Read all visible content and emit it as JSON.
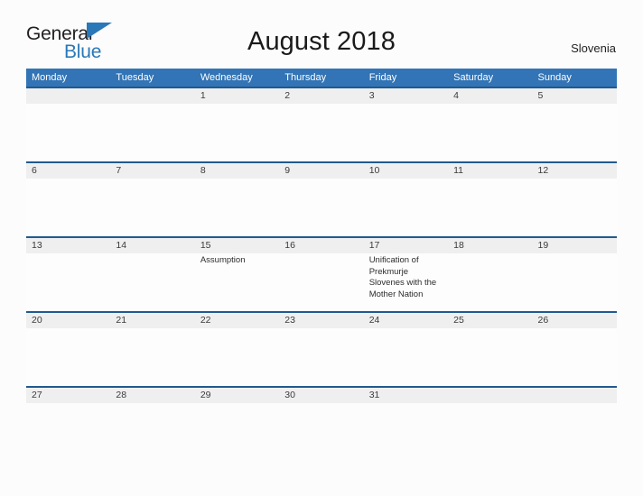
{
  "brand": {
    "line1": "General",
    "line2": "Blue",
    "accent_color": "#2a78b8",
    "text_color": "#231f20"
  },
  "header": {
    "title": "August 2018",
    "country": "Slovenia"
  },
  "calendar": {
    "header_bg": "#3274b5",
    "date_band_bg": "#efefef",
    "week_divider_color": "#21598f",
    "weekdays": [
      "Monday",
      "Tuesday",
      "Wednesday",
      "Thursday",
      "Friday",
      "Saturday",
      "Sunday"
    ],
    "weeks": [
      {
        "days": [
          {
            "num": "",
            "event": ""
          },
          {
            "num": "",
            "event": ""
          },
          {
            "num": "1",
            "event": ""
          },
          {
            "num": "2",
            "event": ""
          },
          {
            "num": "3",
            "event": ""
          },
          {
            "num": "4",
            "event": ""
          },
          {
            "num": "5",
            "event": ""
          }
        ]
      },
      {
        "days": [
          {
            "num": "6",
            "event": ""
          },
          {
            "num": "7",
            "event": ""
          },
          {
            "num": "8",
            "event": ""
          },
          {
            "num": "9",
            "event": ""
          },
          {
            "num": "10",
            "event": ""
          },
          {
            "num": "11",
            "event": ""
          },
          {
            "num": "12",
            "event": ""
          }
        ]
      },
      {
        "days": [
          {
            "num": "13",
            "event": ""
          },
          {
            "num": "14",
            "event": ""
          },
          {
            "num": "15",
            "event": "Assumption"
          },
          {
            "num": "16",
            "event": ""
          },
          {
            "num": "17",
            "event": "Unification of Prekmurje Slovenes with the Mother Nation"
          },
          {
            "num": "18",
            "event": ""
          },
          {
            "num": "19",
            "event": ""
          }
        ]
      },
      {
        "days": [
          {
            "num": "20",
            "event": ""
          },
          {
            "num": "21",
            "event": ""
          },
          {
            "num": "22",
            "event": ""
          },
          {
            "num": "23",
            "event": ""
          },
          {
            "num": "24",
            "event": ""
          },
          {
            "num": "25",
            "event": ""
          },
          {
            "num": "26",
            "event": ""
          }
        ]
      },
      {
        "days": [
          {
            "num": "27",
            "event": ""
          },
          {
            "num": "28",
            "event": ""
          },
          {
            "num": "29",
            "event": ""
          },
          {
            "num": "30",
            "event": ""
          },
          {
            "num": "31",
            "event": ""
          },
          {
            "num": "",
            "event": ""
          },
          {
            "num": "",
            "event": ""
          }
        ]
      }
    ]
  }
}
